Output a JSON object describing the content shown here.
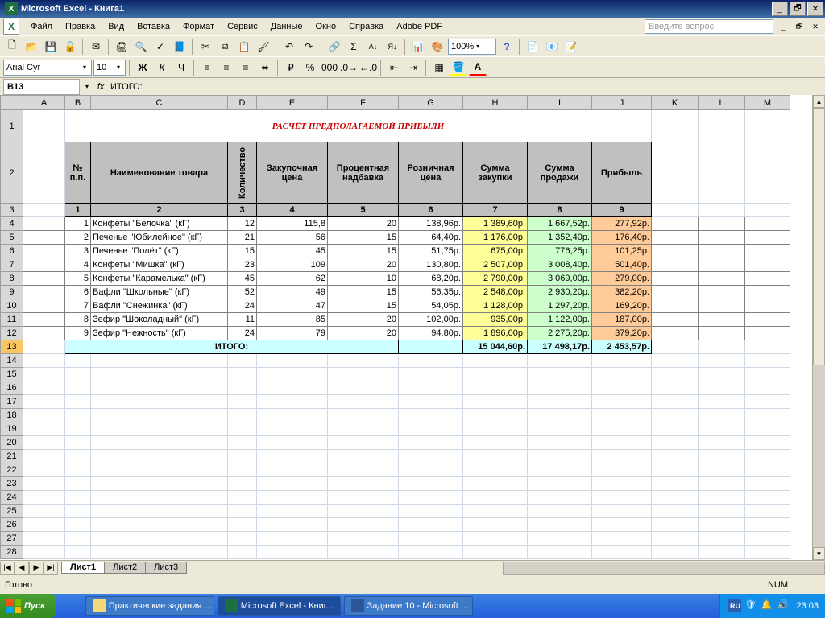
{
  "titlebar": {
    "text": "Microsoft Excel - Книга1"
  },
  "menu": {
    "items": [
      "Файл",
      "Правка",
      "Вид",
      "Вставка",
      "Формат",
      "Сервис",
      "Данные",
      "Окно",
      "Справка",
      "Adobe PDF"
    ],
    "help_placeholder": "Введите вопрос"
  },
  "toolbars": {
    "zoom": "100%",
    "font_name": "Arial Cyr",
    "font_size": "10"
  },
  "formula_bar": {
    "cell_ref": "B13",
    "fx": "fx",
    "content": "ИТОГО:"
  },
  "columns": [
    "A",
    "B",
    "C",
    "D",
    "E",
    "F",
    "G",
    "H",
    "I",
    "J",
    "K",
    "L",
    "M"
  ],
  "row_count": 28,
  "page_title": "РАСЧЁТ ПРЕДПОЛАГАЕМОЙ ПРИБЫЛИ",
  "headers": {
    "c1": "№ п.п.",
    "c2": "Наименование товара",
    "c3": "Количество",
    "c4": "Закупочная цена",
    "c5": "Процентная надбавка",
    "c6": "Розничная цена",
    "c7": "Сумма закупки",
    "c8": "Сумма продажи",
    "c9": "Прибыль"
  },
  "colnums": {
    "c1": "1",
    "c2": "2",
    "c3": "3",
    "c4": "4",
    "c5": "5",
    "c6": "6",
    "c7": "7",
    "c8": "8",
    "c9": "9"
  },
  "rows": [
    {
      "n": "1",
      "name": "Конфеты \"Белочка\" (кГ)",
      "qty": "12",
      "buy": "115,8",
      "pct": "20",
      "retail": "138,96p.",
      "sumbuy": "1 389,60p.",
      "sumsell": "1 667,52p.",
      "profit": "277,92p."
    },
    {
      "n": "2",
      "name": "Печенье \"Юбилейное\" (кГ)",
      "qty": "21",
      "buy": "56",
      "pct": "15",
      "retail": "64,40p.",
      "sumbuy": "1 176,00p.",
      "sumsell": "1 352,40p.",
      "profit": "176,40p."
    },
    {
      "n": "3",
      "name": "Печенье \"Полёт\" (кГ)",
      "qty": "15",
      "buy": "45",
      "pct": "15",
      "retail": "51,75p.",
      "sumbuy": "675,00p.",
      "sumsell": "776,25p.",
      "profit": "101,25p."
    },
    {
      "n": "4",
      "name": "Конфеты \"Мишка\" (кГ)",
      "qty": "23",
      "buy": "109",
      "pct": "20",
      "retail": "130,80p.",
      "sumbuy": "2 507,00p.",
      "sumsell": "3 008,40p.",
      "profit": "501,40p."
    },
    {
      "n": "5",
      "name": "Конфеты \"Карамелька\" (кГ)",
      "qty": "45",
      "buy": "62",
      "pct": "10",
      "retail": "68,20p.",
      "sumbuy": "2 790,00p.",
      "sumsell": "3 069,00p.",
      "profit": "279,00p."
    },
    {
      "n": "6",
      "name": "Вафли \"Школьные\" (кГ)",
      "qty": "52",
      "buy": "49",
      "pct": "15",
      "retail": "56,35p.",
      "sumbuy": "2 548,00p.",
      "sumsell": "2 930,20p.",
      "profit": "382,20p."
    },
    {
      "n": "7",
      "name": "Вафли \"Снежинка\" (кГ)",
      "qty": "24",
      "buy": "47",
      "pct": "15",
      "retail": "54,05p.",
      "sumbuy": "1 128,00p.",
      "sumsell": "1 297,20p.",
      "profit": "169,20p."
    },
    {
      "n": "8",
      "name": "Зефир \"Шоколадный\" (кГ)",
      "qty": "11",
      "buy": "85",
      "pct": "20",
      "retail": "102,00p.",
      "sumbuy": "935,00p.",
      "sumsell": "1 122,00p.",
      "profit": "187,00p."
    },
    {
      "n": "9",
      "name": "Зефир \"Нежность\" (кГ)",
      "qty": "24",
      "buy": "79",
      "pct": "20",
      "retail": "94,80p.",
      "sumbuy": "1 896,00p.",
      "sumsell": "2 275,20p.",
      "profit": "379,20p."
    }
  ],
  "totals": {
    "label": "ИТОГО:",
    "sumbuy": "15 044,60p.",
    "sumsell": "17 498,17p.",
    "profit": "2 453,57p."
  },
  "sheets": [
    "Лист1",
    "Лист2",
    "Лист3"
  ],
  "status": {
    "ready": "Готово",
    "num": "NUM"
  },
  "taskbar": {
    "start": "Пуск",
    "items": [
      "Практические задания ...",
      "Microsoft Excel - Книг...",
      "Задание 10 - Microsoft ..."
    ],
    "lang": "RU",
    "clock": "23:03"
  }
}
